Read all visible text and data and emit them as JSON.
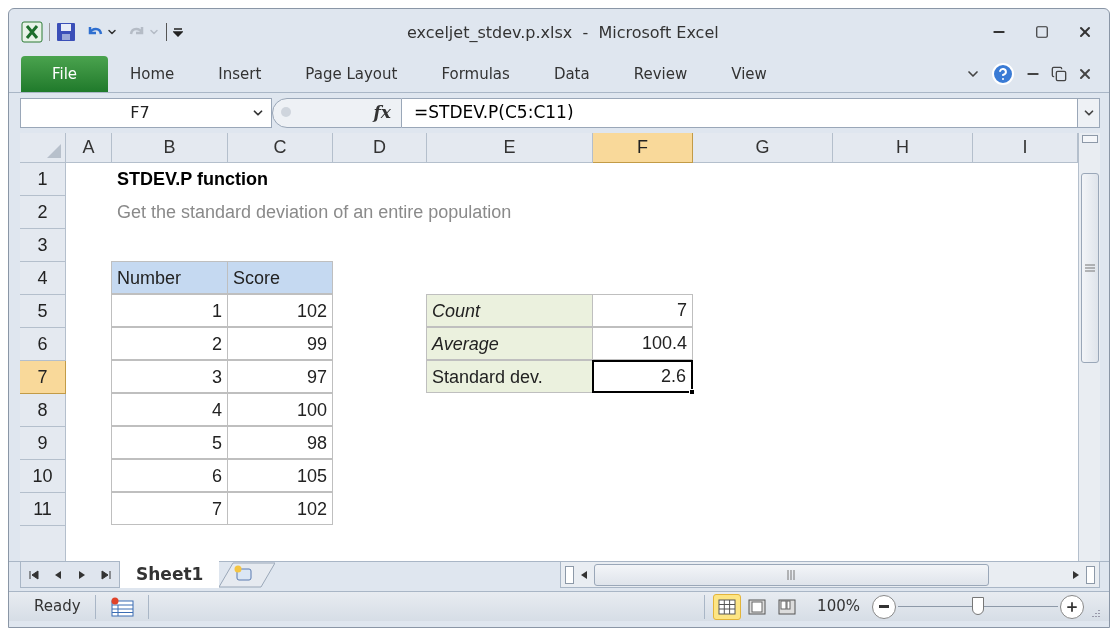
{
  "window": {
    "title": "exceljet_stdev.p.xlsx  -  Microsoft Excel"
  },
  "ribbon_tabs": [
    {
      "label": "File",
      "kind": "file"
    },
    {
      "label": "Home",
      "kind": "tab"
    },
    {
      "label": "Insert",
      "kind": "tab"
    },
    {
      "label": "Page Layout",
      "kind": "tab"
    },
    {
      "label": "Formulas",
      "kind": "tab"
    },
    {
      "label": "Data",
      "kind": "tab"
    },
    {
      "label": "Review",
      "kind": "tab"
    },
    {
      "label": "View",
      "kind": "tab"
    }
  ],
  "formula_bar": {
    "name_box": "F7",
    "function_label": "fx",
    "formula": "=STDEV.P(C5:C11)"
  },
  "columns": [
    {
      "label": "A",
      "selected": false
    },
    {
      "label": "B",
      "selected": false
    },
    {
      "label": "C",
      "selected": false
    },
    {
      "label": "D",
      "selected": false
    },
    {
      "label": "E",
      "selected": false
    },
    {
      "label": "F",
      "selected": true
    },
    {
      "label": "G",
      "selected": false
    },
    {
      "label": "H",
      "selected": false
    },
    {
      "label": "I",
      "selected": false
    }
  ],
  "rows": [
    {
      "label": "1",
      "selected": false,
      "cells": [
        {
          "kind": "blank"
        },
        {
          "kind": "title",
          "text": "STDEV.P function"
        }
      ]
    },
    {
      "label": "2",
      "selected": false,
      "cells": [
        {
          "kind": "blank"
        },
        {
          "kind": "subtitle",
          "text": "Get the standard deviation of an entire population"
        }
      ]
    },
    {
      "label": "3",
      "selected": false,
      "cells": []
    },
    {
      "label": "4",
      "selected": false,
      "cells": [
        {
          "kind": "blank"
        },
        {
          "kind": "table-header",
          "text": "Number"
        },
        {
          "kind": "table-header",
          "text": "Score"
        }
      ]
    },
    {
      "label": "5",
      "selected": false,
      "cells": [
        {
          "kind": "blank"
        },
        {
          "kind": "table-value",
          "text": "1"
        },
        {
          "kind": "table-value",
          "text": "102"
        },
        {
          "kind": "blank"
        },
        {
          "kind": "summary-label",
          "text": "Count",
          "italic": true
        },
        {
          "kind": "summary-value",
          "text": "7",
          "selected": false
        }
      ]
    },
    {
      "label": "6",
      "selected": false,
      "cells": [
        {
          "kind": "blank"
        },
        {
          "kind": "table-value",
          "text": "2"
        },
        {
          "kind": "table-value",
          "text": "99"
        },
        {
          "kind": "blank"
        },
        {
          "kind": "summary-label",
          "text": "Average",
          "italic": true
        },
        {
          "kind": "summary-value",
          "text": "100.4",
          "selected": false
        }
      ]
    },
    {
      "label": "7",
      "selected": true,
      "cells": [
        {
          "kind": "blank"
        },
        {
          "kind": "table-value",
          "text": "3"
        },
        {
          "kind": "table-value",
          "text": "97"
        },
        {
          "kind": "blank"
        },
        {
          "kind": "summary-label",
          "text": "Standard dev.",
          "italic": false
        },
        {
          "kind": "summary-value",
          "text": "2.6",
          "selected": true
        }
      ]
    },
    {
      "label": "8",
      "selected": false,
      "cells": [
        {
          "kind": "blank"
        },
        {
          "kind": "table-value",
          "text": "4"
        },
        {
          "kind": "table-value",
          "text": "100"
        }
      ]
    },
    {
      "label": "9",
      "selected": false,
      "cells": [
        {
          "kind": "blank"
        },
        {
          "kind": "table-value",
          "text": "5"
        },
        {
          "kind": "table-value",
          "text": "98"
        }
      ]
    },
    {
      "label": "10",
      "selected": false,
      "cells": [
        {
          "kind": "blank"
        },
        {
          "kind": "table-value",
          "text": "6"
        },
        {
          "kind": "table-value",
          "text": "105"
        }
      ]
    },
    {
      "label": "11",
      "selected": false,
      "cells": [
        {
          "kind": "blank"
        },
        {
          "kind": "table-value",
          "text": "7"
        },
        {
          "kind": "table-value",
          "text": "102"
        }
      ]
    }
  ],
  "sheet_tabs": [
    {
      "label": "Sheet1",
      "selected": true
    }
  ],
  "status_bar": {
    "status": "Ready",
    "views": [
      {
        "kind": "normal",
        "selected": true
      },
      {
        "kind": "page-layout",
        "selected": false
      },
      {
        "kind": "page-break",
        "selected": false
      }
    ],
    "zoom": "100%",
    "zoom_slider": {
      "level": 0.5
    }
  }
}
